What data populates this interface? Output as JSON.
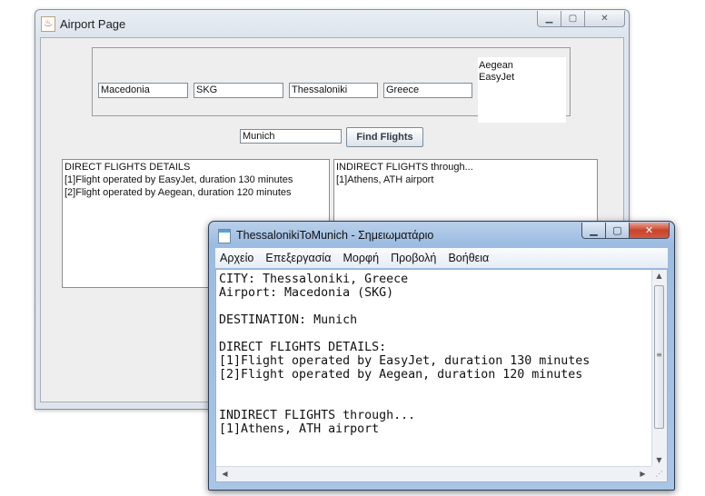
{
  "airport_window": {
    "title": "Airport Page",
    "icon": "java-cup-icon",
    "fields": {
      "airport_name": "Macedonia",
      "airport_code": "SKG",
      "city": "Thessaloniki",
      "country": "Greece"
    },
    "airlines": [
      "Aegean",
      "EasyJet"
    ],
    "destination_value": "Munich",
    "find_button_label": "Find Flights",
    "direct_flights_text": "DIRECT FLIGHTS DETAILS\n[1]Flight operated by EasyJet, duration 130 minutes\n[2]Flight operated by Aegean, duration 120 minutes",
    "indirect_flights_text": "INDIRECT FLIGHTS through...\n[1]Athens, ATH airport"
  },
  "notepad_window": {
    "title": "ThessalonikiToMunich - Σημειωματάριο",
    "menu": [
      "Αρχείο",
      "Επεξεργασία",
      "Μορφή",
      "Προβολή",
      "Βοήθεια"
    ],
    "content": "CITY: Thessaloniki, Greece\nAirport: Macedonia (SKG)\n\nDESTINATION: Munich\n\nDIRECT FLIGHTS DETAILS:\n[1]Flight operated by EasyJet, duration 130 minutes\n[2]Flight operated by Aegean, duration 120 minutes\n\n\nINDIRECT FLIGHTS through...\n[1]Athens, ATH airport"
  }
}
